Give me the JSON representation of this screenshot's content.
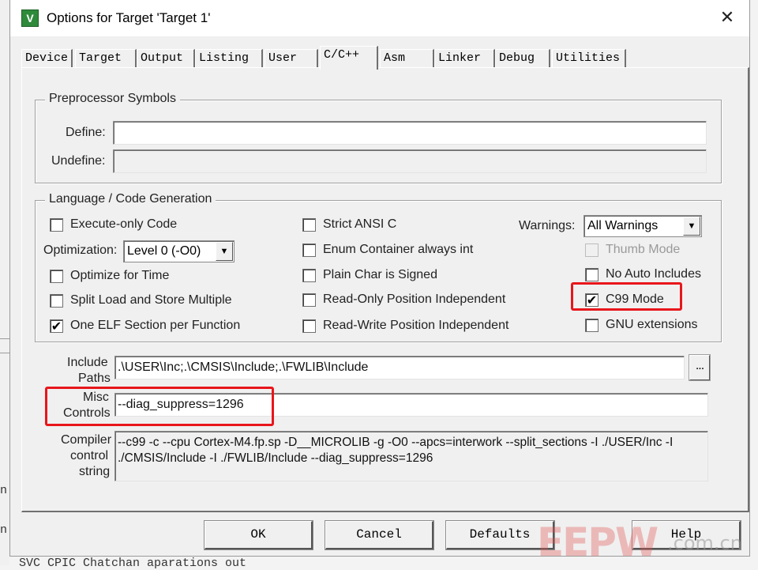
{
  "window": {
    "title": "Options for Target 'Target 1'",
    "close_glyph": "✕",
    "app_icon_glyph": "V"
  },
  "tabs": [
    {
      "label": "Device"
    },
    {
      "label": "Target"
    },
    {
      "label": "Output"
    },
    {
      "label": "Listing"
    },
    {
      "label": "User"
    },
    {
      "label": "C/C++",
      "active": true
    },
    {
      "label": "Asm"
    },
    {
      "label": "Linker"
    },
    {
      "label": "Debug"
    },
    {
      "label": "Utilities"
    }
  ],
  "preprocessor": {
    "title": "Preprocessor Symbols",
    "define_label": "Define:",
    "define_value": "",
    "undefine_label": "Undefine:",
    "undefine_value": ""
  },
  "language": {
    "title": "Language / Code Generation",
    "execute_only": {
      "label": "Execute-only Code",
      "checked": false
    },
    "optimization_label": "Optimization:",
    "optimization_value": "Level 0 (-O0)",
    "optimize_time": {
      "label": "Optimize for Time",
      "checked": false
    },
    "split_load": {
      "label": "Split Load and Store Multiple",
      "checked": false
    },
    "one_elf": {
      "label": "One ELF Section per Function",
      "checked": true
    },
    "strict_ansi": {
      "label": "Strict ANSI C",
      "checked": false
    },
    "enum_container": {
      "label": "Enum Container always int",
      "checked": false
    },
    "plain_char": {
      "label": "Plain Char is Signed",
      "checked": false
    },
    "ropi": {
      "label": "Read-Only Position Independent",
      "checked": false
    },
    "rwpi": {
      "label": "Read-Write Position Independent",
      "checked": false
    },
    "warnings_label": "Warnings:",
    "warnings_value": "All Warnings",
    "thumb_mode": {
      "label": "Thumb Mode",
      "checked": false,
      "disabled": true
    },
    "no_auto_includes": {
      "label": "No Auto Includes",
      "checked": false
    },
    "c99_mode": {
      "label": "C99 Mode",
      "checked": true
    },
    "gnu_extensions": {
      "label": "GNU extensions",
      "checked": false
    }
  },
  "include_paths": {
    "label_line1": "Include",
    "label_line2": "Paths",
    "value": ".\\USER\\Inc;.\\CMSIS\\Include;.\\FWLIB\\Include",
    "browse_glyph": "..."
  },
  "misc_controls": {
    "label_line1": "Misc",
    "label_line2": "Controls",
    "value": "--diag_suppress=1296"
  },
  "compiler_string": {
    "label_line1": "Compiler",
    "label_line2": "control",
    "label_line3": "string",
    "value": "--c99 -c --cpu Cortex-M4.fp.sp -D__MICROLIB -g -O0 --apcs=interwork --split_sections -I ./USER/Inc -I ./CMSIS/Include -I ./FWLIB/Include --diag_suppress=1296"
  },
  "buttons": {
    "ok": "OK",
    "cancel": "Cancel",
    "defaults": "Defaults",
    "help": "Help"
  },
  "check_glyph": "✔",
  "select_arrow_glyph": "▼",
  "background": {
    "letter1": "n",
    "letter2": "n",
    "bottom_text": "SVC CPIC Chatchan aparations out"
  },
  "watermark": {
    "brand": "EEPW",
    "domain": ".com.cn"
  },
  "colors": {
    "highlight": "#e8161b",
    "dialog_bg": "#f0f0f0",
    "app_icon": "#2f8a3c"
  }
}
